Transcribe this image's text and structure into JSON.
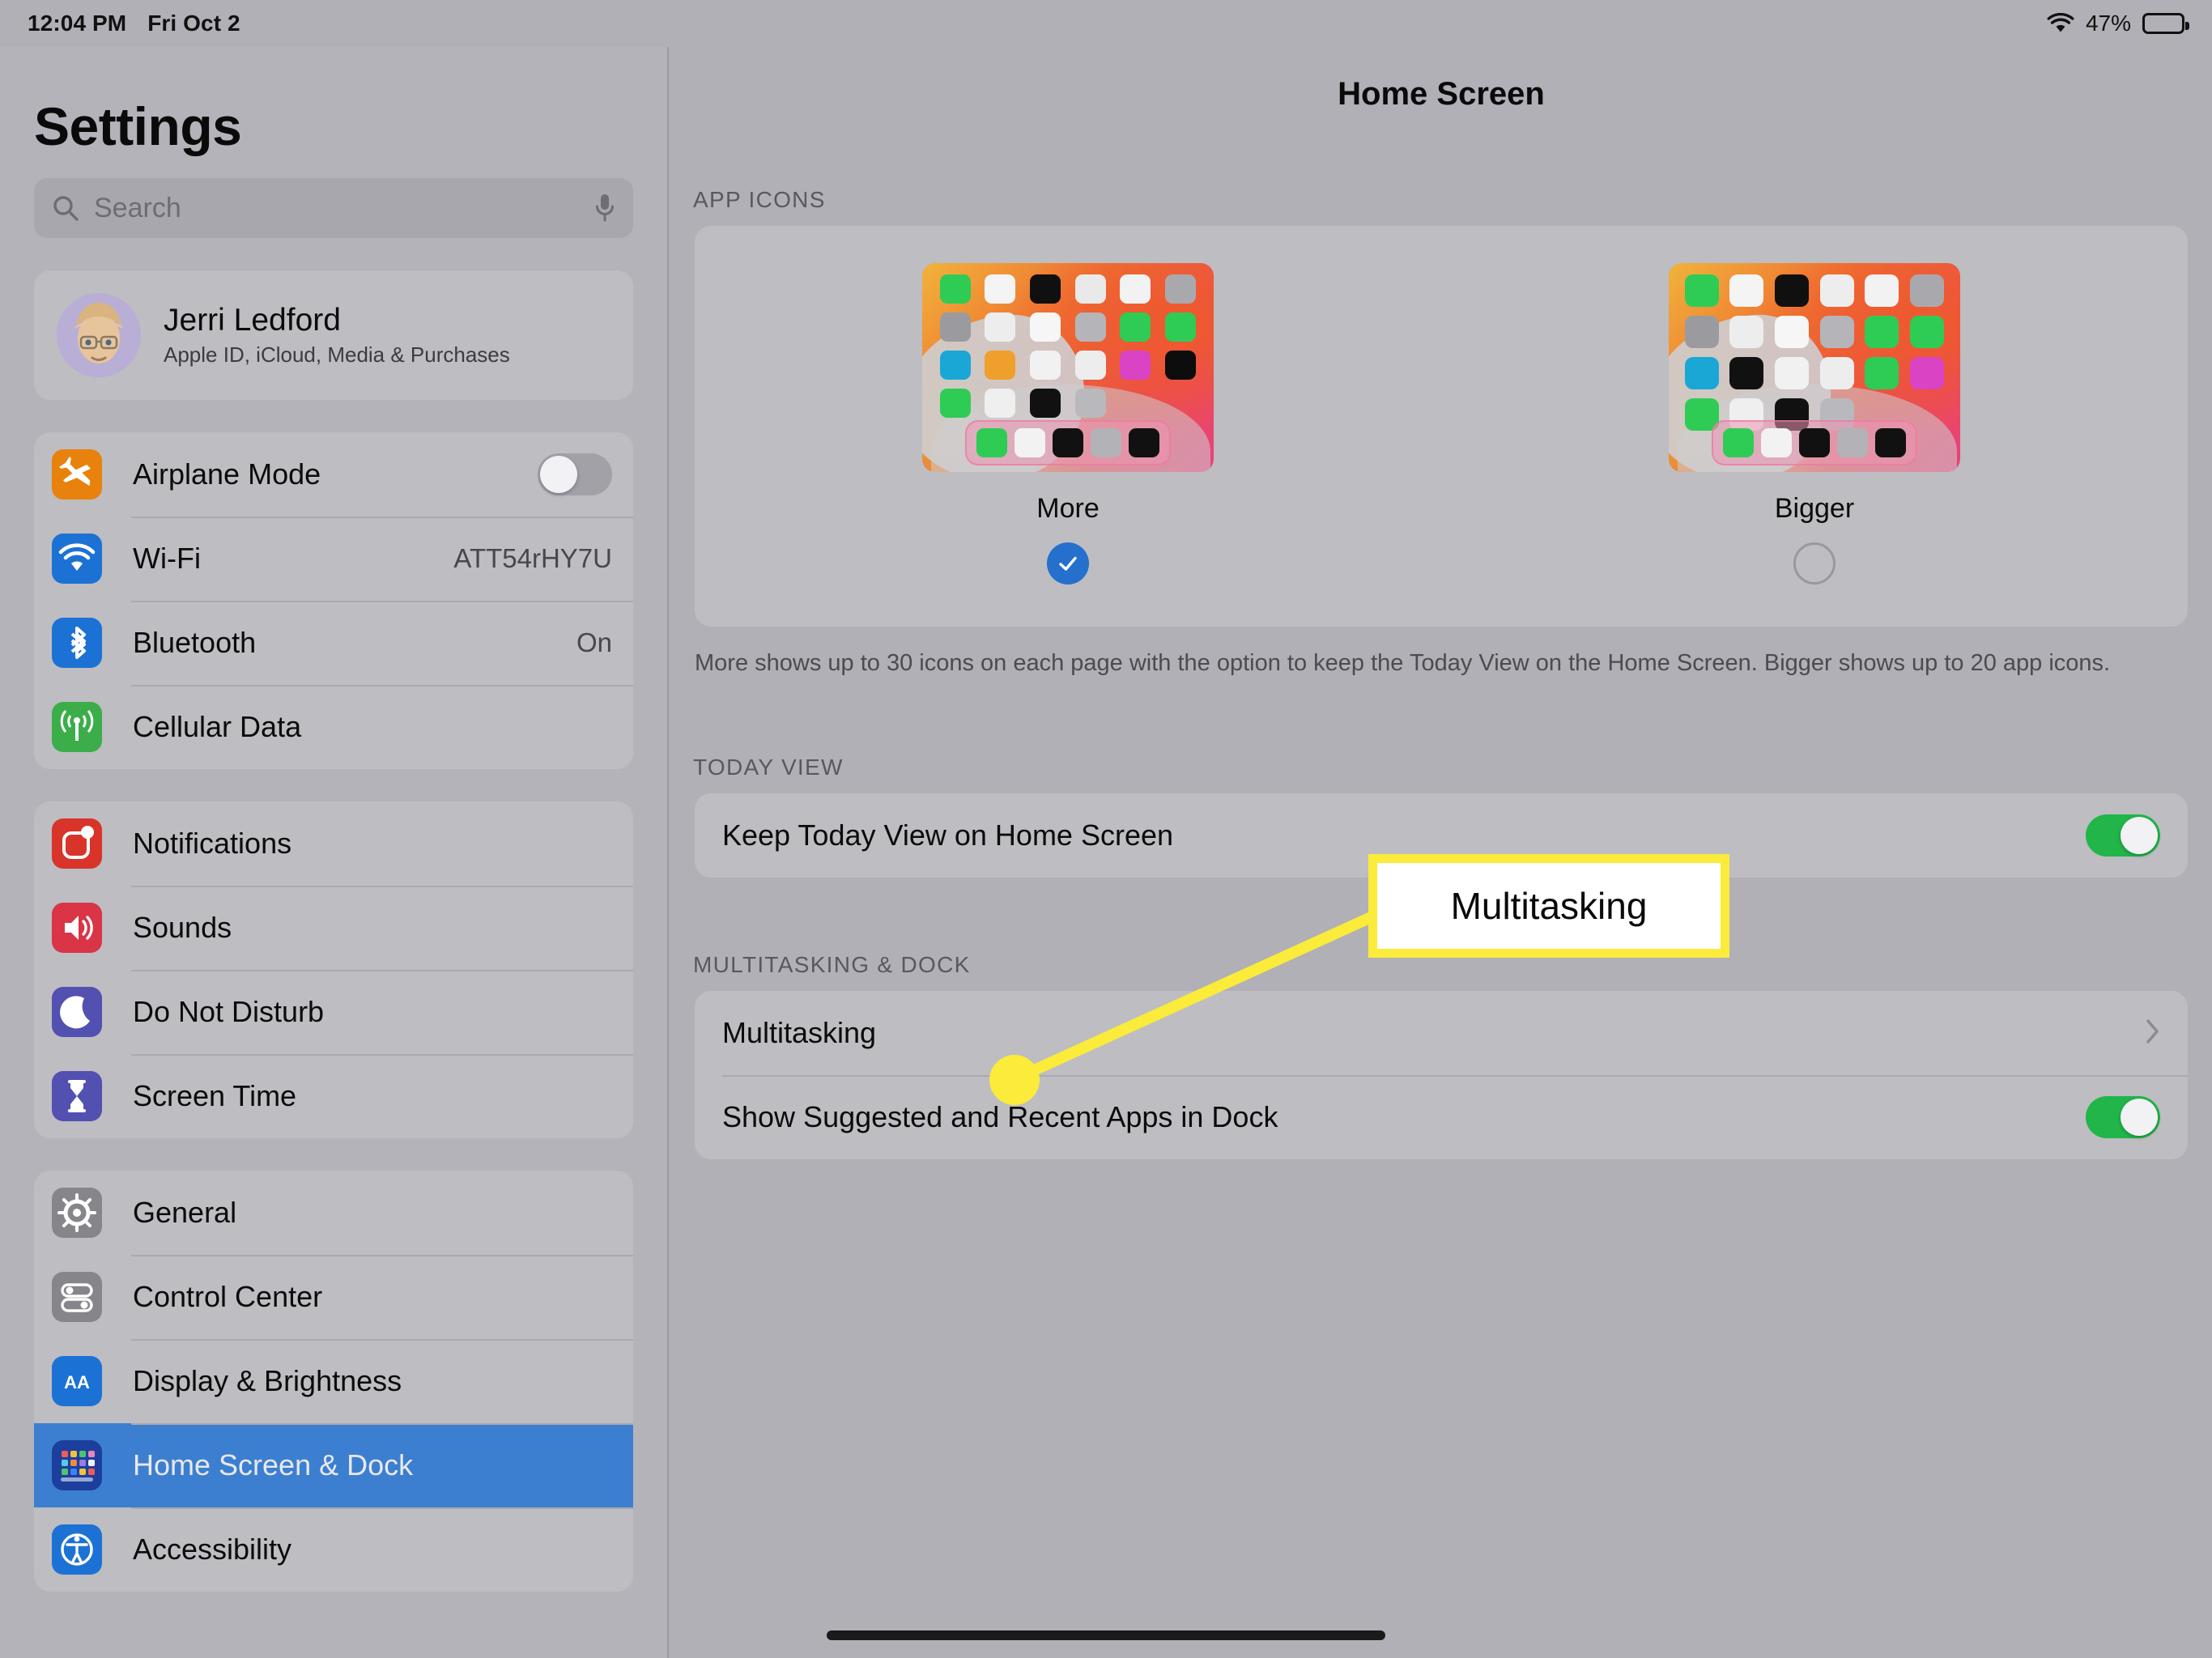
{
  "status_bar": {
    "time": "12:04 PM",
    "date": "Fri Oct 2",
    "battery_percent": "47%",
    "battery_level": 47,
    "wifi_icon": "wifi-icon",
    "battery_icon": "battery-icon"
  },
  "sidebar": {
    "title": "Settings",
    "search": {
      "placeholder": "Search",
      "icon": "search-icon",
      "mic_icon": "microphone-icon"
    },
    "account": {
      "name": "Jerri Ledford",
      "subtitle": "Apple ID, iCloud, Media & Purchases",
      "avatar": "memoji-avatar"
    },
    "groups": [
      {
        "items": [
          {
            "label": "Airplane Mode",
            "icon": "airplane-icon",
            "icon_color": "#e8820c",
            "control": "toggle",
            "toggle_on": false
          },
          {
            "label": "Wi-Fi",
            "icon": "wifi-icon",
            "icon_color": "#1c72d4",
            "control": "value",
            "value": "ATT54rHY7U"
          },
          {
            "label": "Bluetooth",
            "icon": "bluetooth-icon",
            "icon_color": "#1c72d4",
            "control": "value",
            "value": "On"
          },
          {
            "label": "Cellular Data",
            "icon": "cellular-icon",
            "icon_color": "#3bae4a",
            "control": "none",
            "value": ""
          }
        ]
      },
      {
        "items": [
          {
            "label": "Notifications",
            "icon": "notifications-icon",
            "icon_color": "#d8342a",
            "control": "none",
            "value": ""
          },
          {
            "label": "Sounds",
            "icon": "sounds-icon",
            "icon_color": "#da3447",
            "control": "none",
            "value": ""
          },
          {
            "label": "Do Not Disturb",
            "icon": "moon-icon",
            "icon_color": "#5250b0",
            "control": "none",
            "value": ""
          },
          {
            "label": "Screen Time",
            "icon": "hourglass-icon",
            "icon_color": "#5250b0",
            "control": "none",
            "value": ""
          }
        ]
      },
      {
        "items": [
          {
            "label": "General",
            "icon": "gear-icon",
            "icon_color": "#85858b",
            "control": "none",
            "value": ""
          },
          {
            "label": "Control Center",
            "icon": "control-center-icon",
            "icon_color": "#85858b",
            "control": "none",
            "value": ""
          },
          {
            "label": "Display & Brightness",
            "icon": "display-brightness-icon",
            "icon_color": "#1c72d4",
            "control": "none",
            "value": ""
          },
          {
            "label": "Home Screen & Dock",
            "icon": "home-screen-dock-icon",
            "icon_color": "#1c3f9e",
            "control": "none",
            "value": "",
            "selected": true
          },
          {
            "label": "Accessibility",
            "icon": "accessibility-icon",
            "icon_color": "#1c72d4",
            "control": "none",
            "value": ""
          }
        ]
      }
    ]
  },
  "detail": {
    "title": "Home Screen",
    "app_icons": {
      "header": "APP ICONS",
      "options": [
        {
          "label": "More",
          "selected": true,
          "radio_icon": "checkmark-circle-icon"
        },
        {
          "label": "Bigger",
          "selected": false,
          "radio_icon": "empty-circle-icon"
        }
      ],
      "footnote": "More shows up to 30 icons on each page with the option to keep the Today View on the Home Screen. Bigger shows up to 20 app icons."
    },
    "today_view": {
      "header": "TODAY VIEW",
      "rows": [
        {
          "label": "Keep Today View on Home Screen",
          "control": "toggle",
          "toggle_on": true
        }
      ]
    },
    "multitasking_dock": {
      "header": "MULTITASKING & DOCK",
      "rows": [
        {
          "label": "Multitasking",
          "control": "chevron",
          "toggle_on": false
        },
        {
          "label": "Show Suggested and Recent Apps in Dock",
          "control": "toggle",
          "toggle_on": true
        }
      ]
    }
  },
  "annotation": {
    "callout_label": "Multitasking",
    "highlight_color": "#fbeb3b",
    "box_fill": "#ffffff"
  },
  "colors": {
    "background": "#b0b0b6",
    "panel": "#bdbdc2",
    "selected_row": "#3c7fd0",
    "toggle_on": "#21b54a",
    "accent_blue": "#2470cc"
  }
}
